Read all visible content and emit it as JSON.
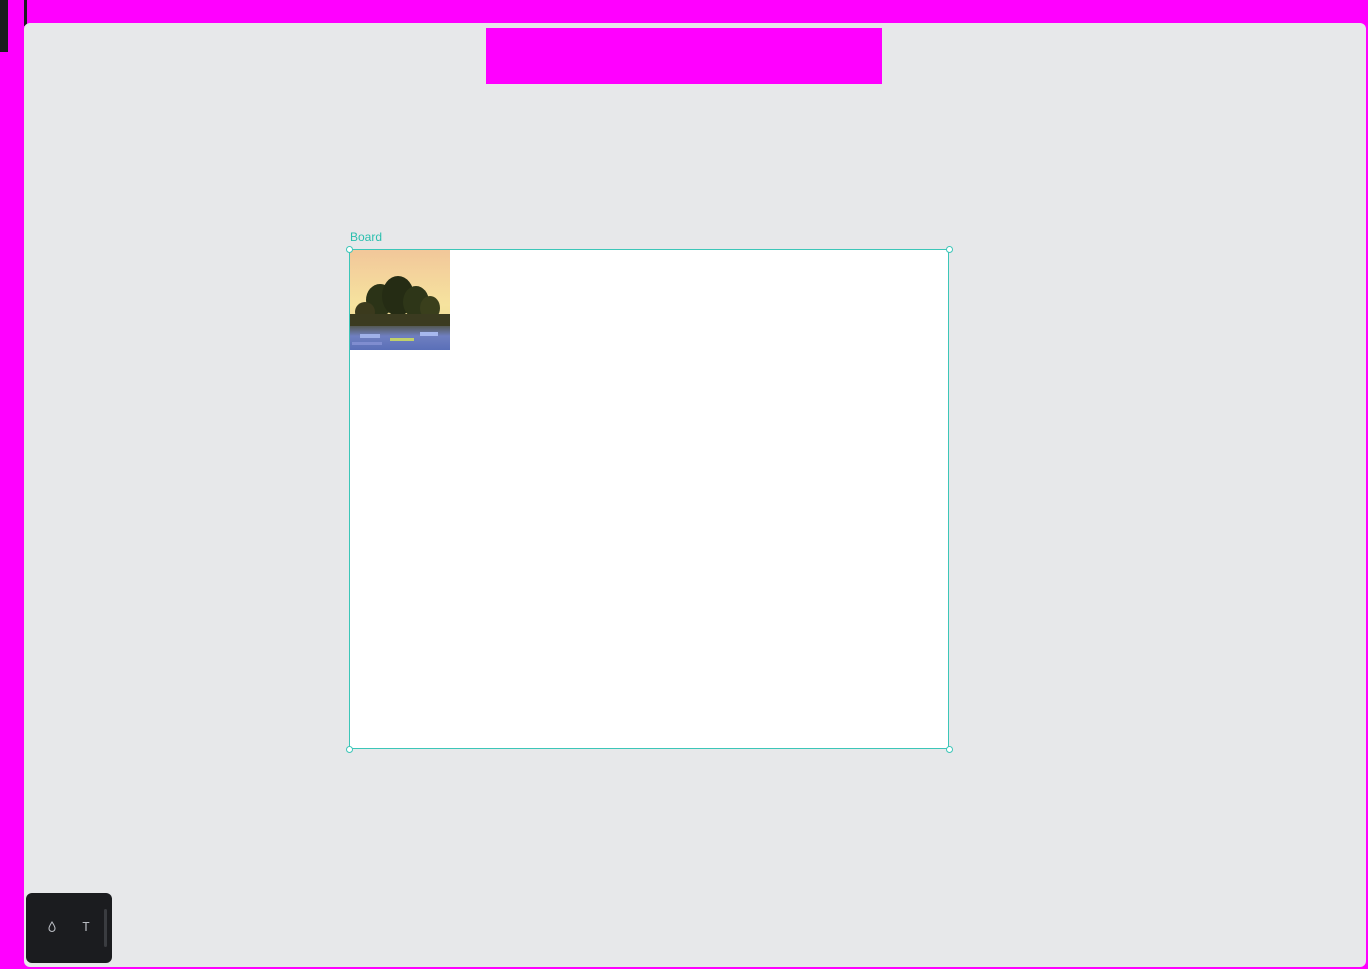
{
  "board": {
    "label": "Board"
  },
  "toolbar": {
    "tools": [
      {
        "name": "drop-tool",
        "icon": "drop-icon"
      },
      {
        "name": "text-tool",
        "icon": "text-icon",
        "glyph": "T"
      }
    ]
  },
  "colors": {
    "accent": "#3cc6b8",
    "canvas_bg": "#e7e8ea",
    "toolbar_bg": "#1b1c1f",
    "placeholder_magenta": "#ff00ff"
  }
}
